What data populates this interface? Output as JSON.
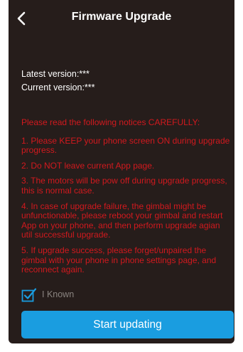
{
  "header": {
    "back_icon": "chevron-left-icon",
    "title": "Firmware Upgrade"
  },
  "versions": {
    "latest": "Latest version:***",
    "current": "Current version:***"
  },
  "notices": {
    "heading": "Please read the following notices CAREFULLY:",
    "items": [
      "1. Please KEEP your phone screen ON during upgrade progress.",
      "2. Do NOT leave current App page.",
      "3. The motors will be pow off during upgrade progress, this is normal case.",
      "4. In case of upgrade failure, the gimbal might be unfunctionable,  please reboot your gimbal and restart App on your phone, and then perform upgrade agian util successful upgrade.",
      "5. If upgrade success, please forget/unpaired the gimbal with your phone in phone settings page, and reconnect again."
    ]
  },
  "acknowledge": {
    "checked": true,
    "label": "I Known"
  },
  "actions": {
    "start_label": "Start updating"
  },
  "colors": {
    "background": "#261d1b",
    "notice_text": "#d2191e",
    "accent": "#1a9de0"
  }
}
